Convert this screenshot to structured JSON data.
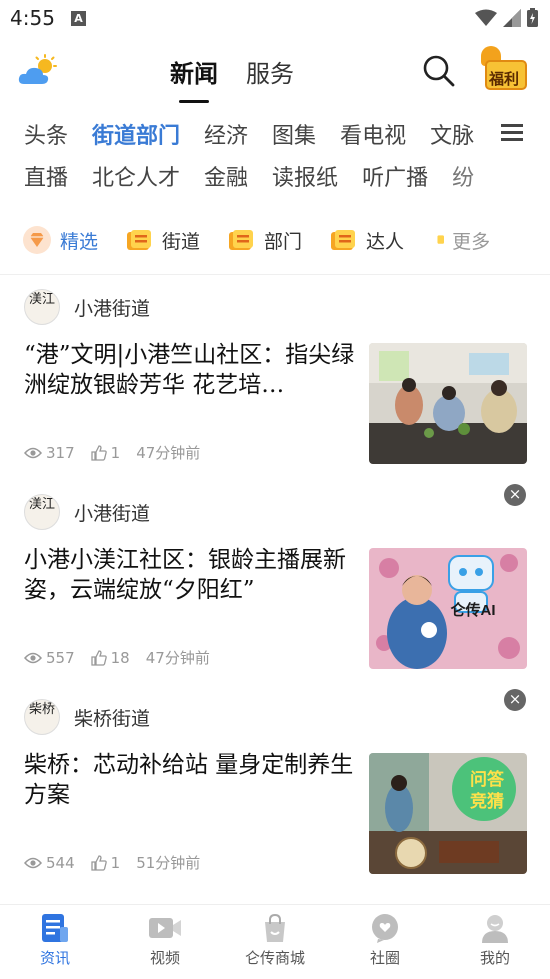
{
  "status": {
    "time": "4:55",
    "a_icon": "A"
  },
  "header": {
    "tabs": [
      {
        "label": "新闻",
        "active": true
      },
      {
        "label": "服务",
        "active": false
      }
    ],
    "fuli_label": "福利"
  },
  "channels": {
    "row1": [
      "头条",
      "街道部门",
      "经济",
      "图集",
      "看电视",
      "文脉"
    ],
    "row2": [
      "直播",
      "北仑人才",
      "金融",
      "读报纸",
      "听广播",
      "纷"
    ],
    "active": "街道部门"
  },
  "subtabs": [
    "精选",
    "街道",
    "部门",
    "达人",
    "更多"
  ],
  "articles": [
    {
      "source": "小港街道",
      "avatar_text": "渼江",
      "title": "“港”文明|小港竺山社区：指尖绿洲绽放银龄芳华 花艺培…",
      "views": "317",
      "likes": "1",
      "time": "47分钟前",
      "closable": false
    },
    {
      "source": "小港街道",
      "avatar_text": "渼江",
      "title": "小港小渼江社区：银龄主播展新姿，云端绽放“夕阳红”",
      "views": "557",
      "likes": "18",
      "time": "47分钟前",
      "closable": true,
      "thumb_text": "仑传AI"
    },
    {
      "source": "柴桥街道",
      "avatar_text": "柴桥",
      "title": "柴桥：芯动补给站 量身定制养生方案",
      "views": "544",
      "likes": "1",
      "time": "51分钟前",
      "closable": true,
      "thumb_text_1": "问答",
      "thumb_text_2": "竞猜"
    }
  ],
  "bottom_nav": [
    {
      "label": "资讯",
      "icon": "news-icon",
      "active": true
    },
    {
      "label": "视频",
      "icon": "video-icon",
      "active": false
    },
    {
      "label": "仑传商城",
      "icon": "shop-bag-icon",
      "active": false
    },
    {
      "label": "社圈",
      "icon": "community-icon",
      "active": false
    },
    {
      "label": "我的",
      "icon": "profile-icon",
      "active": false
    }
  ],
  "colors": {
    "accent": "#3a7bd5",
    "active_bottom": "#2f74e0"
  }
}
